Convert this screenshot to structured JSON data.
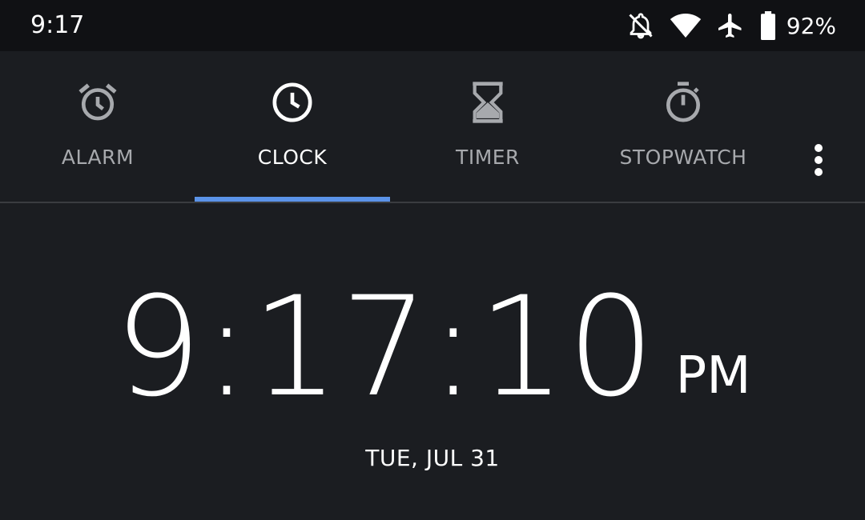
{
  "status_bar": {
    "time": "9:17",
    "battery_percent": "92%",
    "icons": [
      "notifications-off-icon",
      "wifi-icon",
      "airplane-mode-icon",
      "battery-icon"
    ]
  },
  "tabs": [
    {
      "label": "ALARM",
      "icon": "alarm-clock-icon",
      "active": false
    },
    {
      "label": "CLOCK",
      "icon": "clock-icon",
      "active": true
    },
    {
      "label": "TIMER",
      "icon": "hourglass-icon",
      "active": false
    },
    {
      "label": "STOPWATCH",
      "icon": "stopwatch-icon",
      "active": false
    }
  ],
  "menu": {
    "icon": "more-vert-icon"
  },
  "clock": {
    "time": "9:17:10",
    "ampm": "PM",
    "date": "TUE, JUL 31"
  },
  "colors": {
    "background": "#1b1d21",
    "status_bar": "#101114",
    "accent": "#5b93e8",
    "inactive_text": "#a7a9ad",
    "active_text": "#ffffff"
  }
}
